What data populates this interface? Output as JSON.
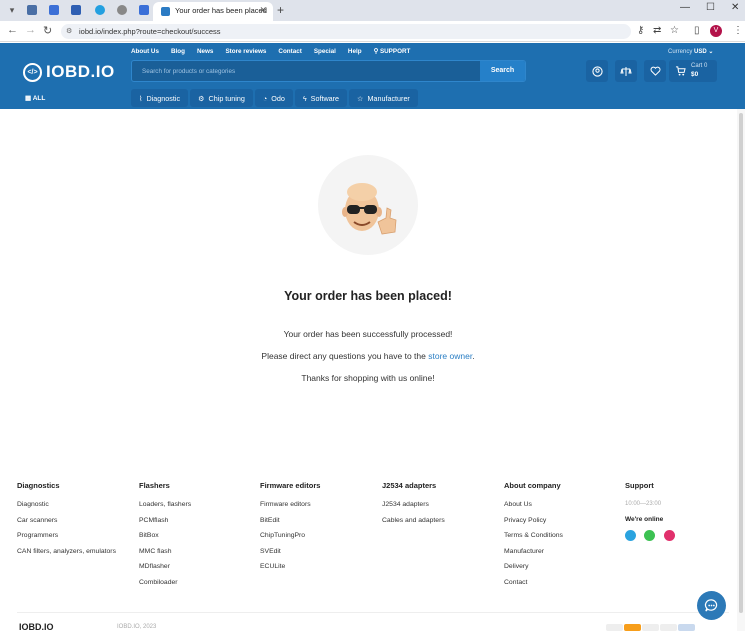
{
  "browser": {
    "active_tab_title": "Your order has been placed",
    "url": "iobd.io/index.php?route=checkout/success",
    "profile_initial": "V"
  },
  "header": {
    "top_nav": [
      "About Us",
      "Blog",
      "News",
      "Store reviews",
      "Contact",
      "Special",
      "Help",
      "SUPPORT"
    ],
    "currency_label": "Currency",
    "currency_value": "USD",
    "logo_text": "IOBD.IO",
    "search_placeholder": "Search for products or categories",
    "search_button": "Search",
    "cart_label": "Cart 0",
    "cart_amount": "$0",
    "all_label": "ALL",
    "categories": [
      "Diagnostic",
      "Chip tuning",
      "Odo",
      "Software",
      "Manufacturer"
    ]
  },
  "main": {
    "heading": "Your order has been placed!",
    "line1": "Your order has been successfully processed!",
    "line2_prefix": "Please direct any questions you have to the ",
    "line2_link": "store owner",
    "line2_suffix": ".",
    "line3": "Thanks for shopping with us online!"
  },
  "footer": {
    "columns": [
      {
        "title": "Diagnostics",
        "links": [
          "Diagnostic",
          "Car scanners",
          "Programmers",
          "CAN filters, analyzers, emulators"
        ]
      },
      {
        "title": "Flashers",
        "links": [
          "Loaders, flashers",
          "PCMflash",
          "BitBox",
          "MMC flash",
          "MDflasher",
          "Combiloader"
        ]
      },
      {
        "title": "Firmware editors",
        "links": [
          "Firmware editors",
          "BitEdit",
          "ChipTuningPro",
          "SVEdit",
          "ECULite"
        ]
      },
      {
        "title": "J2534 adapters",
        "links": [
          "J2534 adapters",
          "Cables and adapters"
        ]
      },
      {
        "title": "About company",
        "links": [
          "About Us",
          "Privacy Policy",
          "Terms & Conditions",
          "Manufacturer",
          "Delivery",
          "Contact"
        ]
      }
    ],
    "support_title": "Support",
    "support_hours": "10:00—23:00",
    "online_label": "We're online",
    "logo_text": "IOBD.IO",
    "copyright": "IOBD.IO, 2023"
  },
  "colors": {
    "brand_blue": "#1e6fb0",
    "link_blue": "#2a7ec4",
    "telegram": "#2aa3df",
    "whatsapp": "#3cc152",
    "instagram": "#e1306c"
  }
}
